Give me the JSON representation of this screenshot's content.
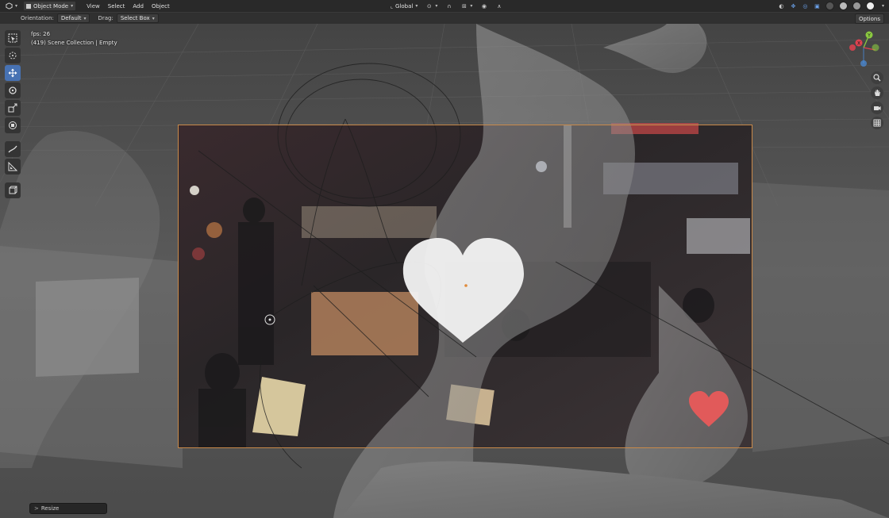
{
  "header": {
    "editor_icon": "cube-icon",
    "mode": "Object Mode",
    "menus": [
      "View",
      "Select",
      "Add",
      "Object"
    ],
    "transform_orientation": "Global"
  },
  "tool_settings": {
    "orientation_label": "Orientation:",
    "orientation_value": "Default",
    "drag_label": "Drag:",
    "drag_value": "Select Box",
    "options_label": "Options"
  },
  "viewport_info": {
    "fps": "fps: 26",
    "collection": "(419) Scene Collection | Empty"
  },
  "gizmo": {
    "x_label": "X",
    "y_label": "Y",
    "z_label": "Z",
    "x_color": "#e0424f",
    "y_color": "#8ac940",
    "z_color": "#4a8fe0"
  },
  "tools": [
    "select-box-icon",
    "cursor-icon",
    "move-icon",
    "rotate-icon",
    "scale-icon",
    "transform-icon",
    "annotate-icon",
    "measure-icon",
    "add-cube-icon"
  ],
  "nav_buttons": [
    "zoom-icon",
    "hand-pan-icon",
    "camera-view-icon",
    "grid-ortho-icon"
  ],
  "last_operator": {
    "label": "Resize",
    "arrow": ">"
  },
  "colors": {
    "accent": "#4772b3",
    "camera_frame": "#c98a4a",
    "heart_red": "#e85a5a"
  }
}
